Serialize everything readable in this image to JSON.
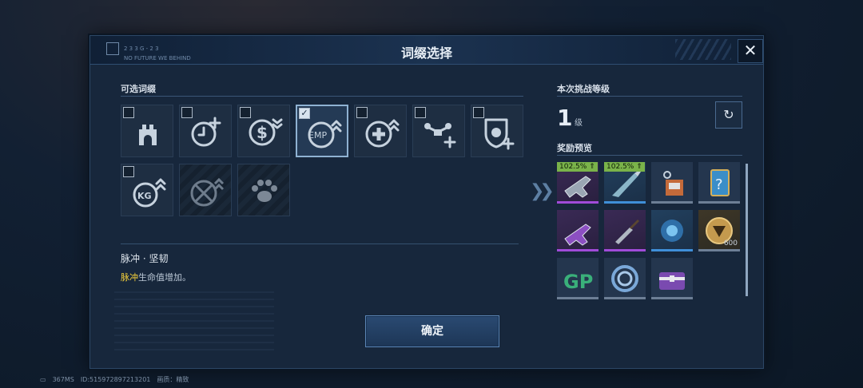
{
  "dialog": {
    "title": "词缀选择",
    "close_label": "✕",
    "header_tag": "2 3 3 G - 2 3",
    "header_tag_sub": "NO FUTURE WE BEHIND"
  },
  "affix_panel": {
    "section_title": "可选词缀",
    "affixes": [
      {
        "icon": "tower-icon",
        "selected": false,
        "locked": false
      },
      {
        "icon": "clock-plus-icon",
        "selected": false,
        "locked": false
      },
      {
        "icon": "dollar-down-icon",
        "selected": false,
        "locked": false
      },
      {
        "icon": "emp-up-icon",
        "selected": true,
        "locked": false,
        "check": "✓"
      },
      {
        "icon": "health-plus-up-icon",
        "selected": false,
        "locked": false
      },
      {
        "icon": "drone-plus-icon",
        "selected": false,
        "locked": false
      },
      {
        "icon": "shield-bug-plus-icon",
        "selected": false,
        "locked": false
      },
      {
        "icon": "kg-weight-up-icon",
        "selected": false,
        "locked": false
      },
      {
        "icon": "no-melee-icon",
        "selected": false,
        "locked": true
      },
      {
        "icon": "paw-icon",
        "selected": false,
        "locked": true
      }
    ],
    "detail_name": "脉冲 · 坚韧",
    "detail_desc_highlight": "脉冲",
    "detail_desc_rest": "生命值增加。"
  },
  "confirm_label": "确定",
  "challenge": {
    "section_title": "本次挑战等级",
    "level": "1",
    "level_unit": "级",
    "refresh_icon": "refresh-icon"
  },
  "rewards": {
    "section_title": "奖励预览",
    "items": [
      {
        "icon": "rifle-icon",
        "badge": "102.5%",
        "rarity": "purple",
        "qty": ""
      },
      {
        "icon": "knife-icon",
        "badge": "102.5%",
        "rarity": "blue",
        "qty": ""
      },
      {
        "icon": "keychain-crate-icon",
        "badge": "",
        "rarity": "gray",
        "qty": ""
      },
      {
        "icon": "card-question-icon",
        "badge": "",
        "rarity": "gray",
        "qty": ""
      },
      {
        "icon": "rifle-purple-icon",
        "badge": "",
        "rarity": "purple",
        "qty": ""
      },
      {
        "icon": "folding-knife-icon",
        "badge": "",
        "rarity": "purple",
        "qty": ""
      },
      {
        "icon": "blue-armor-icon",
        "badge": "",
        "rarity": "blue",
        "qty": ""
      },
      {
        "icon": "gold-coin-icon",
        "badge": "",
        "rarity": "gold",
        "qty": "600"
      },
      {
        "icon": "gp-currency-icon",
        "badge": "",
        "rarity": "gray",
        "qty": ""
      },
      {
        "icon": "ring-token-icon",
        "badge": "",
        "rarity": "gray",
        "qty": ""
      },
      {
        "icon": "purple-chest-icon",
        "badge": "",
        "rarity": "gray",
        "qty": ""
      }
    ]
  },
  "footer": {
    "ping": "367MS",
    "id": "ID:515972897213201",
    "quality_label": "画质：精致"
  },
  "colors": {
    "highlight": "#f3cf3a",
    "badge_green": "#7ab34a",
    "rarity_purple": "#a04bd8",
    "rarity_blue": "#3f8fd8"
  }
}
